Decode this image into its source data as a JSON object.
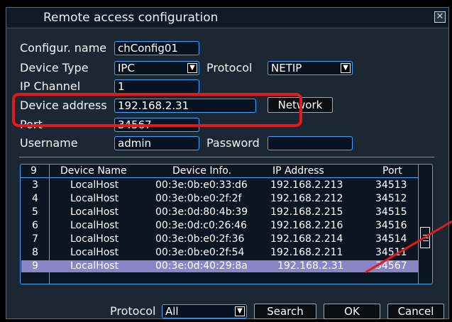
{
  "window": {
    "title": "Remote access configuration",
    "close_glyph": "✕"
  },
  "form": {
    "config_name_label": "Configur. name",
    "config_name_value": "chConfig01",
    "device_type_label": "Device Type",
    "device_type_value": "IPC",
    "protocol_label": "Protocol",
    "protocol_value": "NETIP",
    "ip_channel_label": "IP Channel",
    "ip_channel_value": "1",
    "device_address_label": "Device address",
    "device_address_value": "192.168.2.31",
    "network_button": "Network",
    "port_label": "Port",
    "port_value": "34567",
    "username_label": "Username",
    "username_value": "admin",
    "password_label": "Password",
    "password_value": ""
  },
  "table": {
    "headers": [
      "9",
      "Device Name",
      "Device Info.",
      "IP Address",
      "Port"
    ],
    "rows": [
      [
        "3",
        "LocalHost",
        "00:3e:0b:e0:33:d6",
        "192.168.2.213",
        "34513"
      ],
      [
        "4",
        "LocalHost",
        "00:3e:0b:e0:2f:2f",
        "192.168.2.212",
        "34512"
      ],
      [
        "5",
        "LocalHost",
        "00:3e:0d:80:4b:39",
        "192.168.2.215",
        "34515"
      ],
      [
        "6",
        "LocalHost",
        "00:3e:0d:c0:26:46",
        "192.168.2.216",
        "34516"
      ],
      [
        "7",
        "LocalHost",
        "00:3e:0b:e0:2f:36",
        "192.168.2.214",
        "34514"
      ],
      [
        "8",
        "LocalHost",
        "00:3e:0b:e0:2f:54",
        "192.168.2.211",
        "34511"
      ],
      [
        "9",
        "LocalHost",
        "00:3e:0d:40:29:8a",
        "192.168.2.31",
        "34567"
      ]
    ],
    "selected_index": 6
  },
  "footer": {
    "protocol_label": "Protocol",
    "protocol_value": "All",
    "search_button": "Search",
    "ok_button": "OK",
    "cancel_button": "Cancel"
  },
  "colors": {
    "highlight": "#e5191b",
    "accent": "#3ea5ff",
    "selected_row": "#8a86c6"
  }
}
